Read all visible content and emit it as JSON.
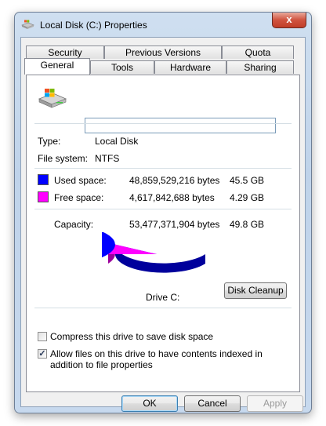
{
  "window": {
    "title": "Local Disk (C:) Properties",
    "close_glyph": "x"
  },
  "tabs_back": [
    "Security",
    "Previous Versions",
    "Quota"
  ],
  "tabs_front": [
    "General",
    "Tools",
    "Hardware",
    "Sharing"
  ],
  "active_tab": "General",
  "general": {
    "drive_name_value": "",
    "type_label": "Type:",
    "type_value": "Local Disk",
    "fs_label": "File system:",
    "fs_value": "NTFS",
    "used_label": "Used space:",
    "used_bytes": "48,859,529,216 bytes",
    "used_gb": "45.5 GB",
    "free_label": "Free space:",
    "free_bytes": "4,617,842,688 bytes",
    "free_gb": "4.29 GB",
    "capacity_label": "Capacity:",
    "capacity_bytes": "53,477,371,904 bytes",
    "capacity_gb": "49.8 GB",
    "drive_label": "Drive C:",
    "cleanup_button": "Disk Cleanup",
    "compress_label": "Compress this drive to save disk space",
    "compress_checked": false,
    "index_label": "Allow files on this drive to have contents indexed in addition to file properties",
    "index_checked": true
  },
  "colors": {
    "used": "#0000ff",
    "free": "#ff00ff"
  },
  "pie": {
    "used_fraction": 0.9137
  },
  "buttons": {
    "ok": "OK",
    "cancel": "Cancel",
    "apply": "Apply"
  },
  "icons": {
    "title_icon": "drive-icon",
    "drive_icon": "drive-icon"
  }
}
